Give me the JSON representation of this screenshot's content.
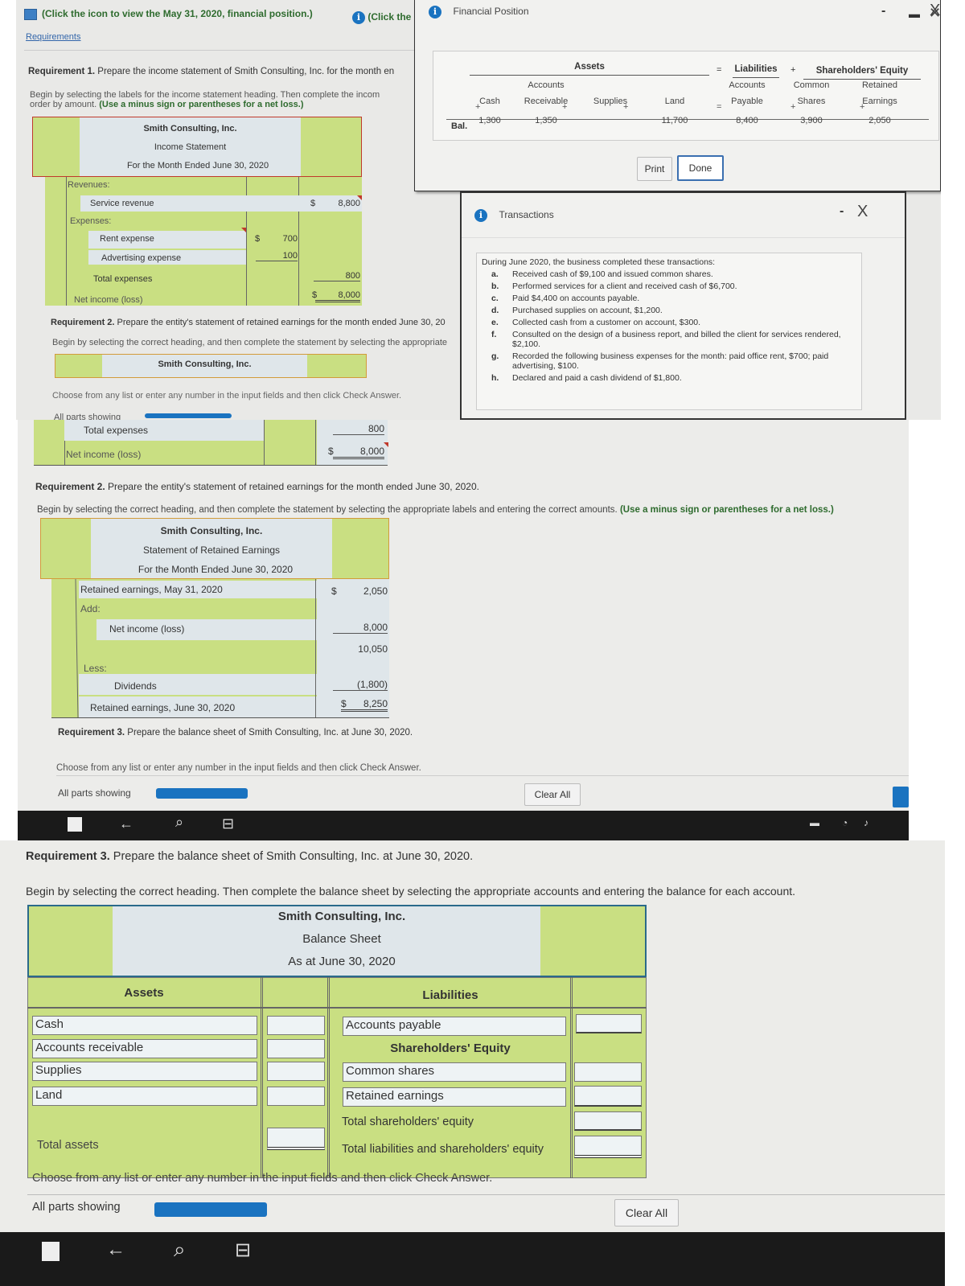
{
  "top_panel": {
    "prompt_line": "(Click the icon to view the May 31, 2020, financial position.)",
    "info_link": "(Click the",
    "requirements_link": "Requirements",
    "req1_title_bold": "Requirement 1.",
    "req1_title": "Prepare the income statement of Smith Consulting, Inc. for the month en",
    "req1_instr": "Begin by selecting the labels for the income statement heading. Then complete the incom",
    "req1_instr2": "order by amount.",
    "req1_instr_green": "(Use a minus sign or parentheses for a net loss.)",
    "income_statement": {
      "company": "Smith Consulting, Inc.",
      "title": "Income Statement",
      "period": "For the Month Ended June 30, 2020",
      "revenues_label": "Revenues:",
      "service_revenue_label": "Service revenue",
      "service_revenue_currency": "$",
      "service_revenue": "8,800",
      "expenses_label": "Expenses:",
      "rent_label": "Rent expense",
      "rent_currency": "$",
      "rent": "700",
      "advertising_label": "Advertising expense",
      "advertising": "100",
      "total_expenses_label": "Total expenses",
      "total_expenses": "800",
      "net_income_label": "Net income (loss)",
      "net_income_currency": "$",
      "net_income": "8,000"
    },
    "req2_title_bold": "Requirement 2.",
    "req2_title": "Prepare the entity's statement of retained earnings for the month ended June 30, 20",
    "req2_instr": "Begin by selecting the correct heading, and then complete the statement by selecting the appropriate",
    "re_heading_company": "Smith Consulting, Inc.",
    "choose_text": "Choose from any list or enter any number in the input fields and then click Check Answer.",
    "all_parts": "All parts showing"
  },
  "financial_position_dialog": {
    "title": "Financial Position",
    "minimize": "-",
    "close": "X",
    "assets_header": "Assets",
    "eq1": "=",
    "liabilities_header": "Liabilities",
    "plus": "+",
    "equity_header": "Shareholders' Equity",
    "columns": [
      {
        "top": "",
        "bottom": "Cash"
      },
      {
        "top": "Accounts",
        "bottom": "Receivable"
      },
      {
        "top": "",
        "bottom": "Supplies"
      },
      {
        "top": "",
        "bottom": "Land"
      },
      {
        "top": "Accounts",
        "bottom": "Payable"
      },
      {
        "top": "Common",
        "bottom": "Shares"
      },
      {
        "top": "Retained",
        "bottom": "Earnings"
      }
    ],
    "bal_label": "Bal.",
    "balances": [
      "1,300",
      "1,350",
      "",
      "11,700",
      "8,400",
      "3,900",
      "2,050"
    ],
    "print_label": "Print",
    "done_label": "Done"
  },
  "transactions_dialog": {
    "title": "Transactions",
    "minimize": "-",
    "close": "X",
    "intro": "During June 2020, the business completed these transactions:",
    "items": [
      {
        "letter": "a.",
        "text": "Received cash of $9,100 and issued common shares."
      },
      {
        "letter": "b.",
        "text": "Performed services for a client and received cash of $6,700."
      },
      {
        "letter": "c.",
        "text": "Paid $4,400 on accounts payable."
      },
      {
        "letter": "d.",
        "text": "Purchased supplies on account, $1,200."
      },
      {
        "letter": "e.",
        "text": "Collected cash from a customer on account, $300."
      },
      {
        "letter": "f.",
        "text": "Consulted on the design of a business report, and billed the client for services rendered, $2,100."
      },
      {
        "letter": "g.",
        "text": "Recorded the following business expenses for the month: paid office rent, $700; paid advertising, $100."
      },
      {
        "letter": "h.",
        "text": "Declared and paid a cash dividend of $1,800."
      }
    ]
  },
  "middle_panel": {
    "total_expenses_label": "Total expenses",
    "total_expenses": "800",
    "net_income_label": "Net income (loss)",
    "net_income_currency": "$",
    "net_income": "8,000",
    "req2_title_bold": "Requirement 2.",
    "req2_title": "Prepare the entity's statement of retained earnings for the month ended June 30, 2020.",
    "req2_instr": "Begin by selecting the correct heading, and then complete the statement by selecting the appropriate labels and entering the correct amounts.",
    "req2_instr_green": "(Use a minus sign or parentheses for a net loss.)",
    "retained_earnings": {
      "company": "Smith Consulting, Inc.",
      "title": "Statement of Retained Earnings",
      "period": "For the Month Ended June 30, 2020",
      "re_start_label": "Retained earnings, May 31, 2020",
      "re_start_currency": "$",
      "re_start": "2,050",
      "add_label": "Add:",
      "net_income_label": "Net income (loss)",
      "net_income": "8,000",
      "subtotal": "10,050",
      "less_label": "Less:",
      "dividends_label": "Dividends",
      "dividends": "(1,800)",
      "re_end_label": "Retained earnings, June 30, 2020",
      "re_end_currency": "$",
      "re_end": "8,250"
    },
    "req3_title_bold": "Requirement 3.",
    "req3_title": "Prepare the balance sheet of Smith Consulting, Inc. at June 30, 2020.",
    "choose_text": "Choose from any list or enter any number in the input fields and then click Check Answer.",
    "all_parts": "All parts showing",
    "parts_progress": 1.0,
    "clear_all": "Clear All"
  },
  "bottom_panel": {
    "req3_title_bold": "Requirement 3.",
    "req3_title": "Prepare the balance sheet of Smith Consulting, Inc. at June 30, 2020.",
    "req3_instr": "Begin by selecting the correct heading. Then complete the balance sheet by selecting the appropriate accounts and entering the balance for each account.",
    "balance_sheet": {
      "company": "Smith Consulting, Inc.",
      "title": "Balance Sheet",
      "date": "As at June 30, 2020",
      "assets_header": "Assets",
      "liabilities_header": "Liabilities",
      "equity_header": "Shareholders' Equity",
      "asset_rows": [
        "Cash",
        "Accounts receivable",
        "Supplies",
        "Land"
      ],
      "asset_values": [
        "",
        "",
        "",
        ""
      ],
      "total_assets_label": "Total assets",
      "total_assets": "",
      "accounts_payable_label": "Accounts payable",
      "accounts_payable": "",
      "common_shares_label": "Common shares",
      "common_shares": "",
      "retained_earnings_label": "Retained earnings",
      "retained_earnings": "",
      "total_equity_label": "Total shareholders' equity",
      "total_equity": "",
      "total_le_label": "Total liabilities and shareholders' equity",
      "total_le": ""
    },
    "choose_text": "Choose from any list or enter any number in the input fields and then click Check Answer.",
    "all_parts": "All parts showing",
    "parts_progress": 1.0,
    "clear_all": "Clear All"
  },
  "taskbar": {
    "icons": [
      "windows-start-icon",
      "back-arrow-icon",
      "search-icon",
      "task-view-icon"
    ],
    "glyphs": {
      "back": "←",
      "search": "⌕",
      "taskview": "⊟"
    }
  }
}
